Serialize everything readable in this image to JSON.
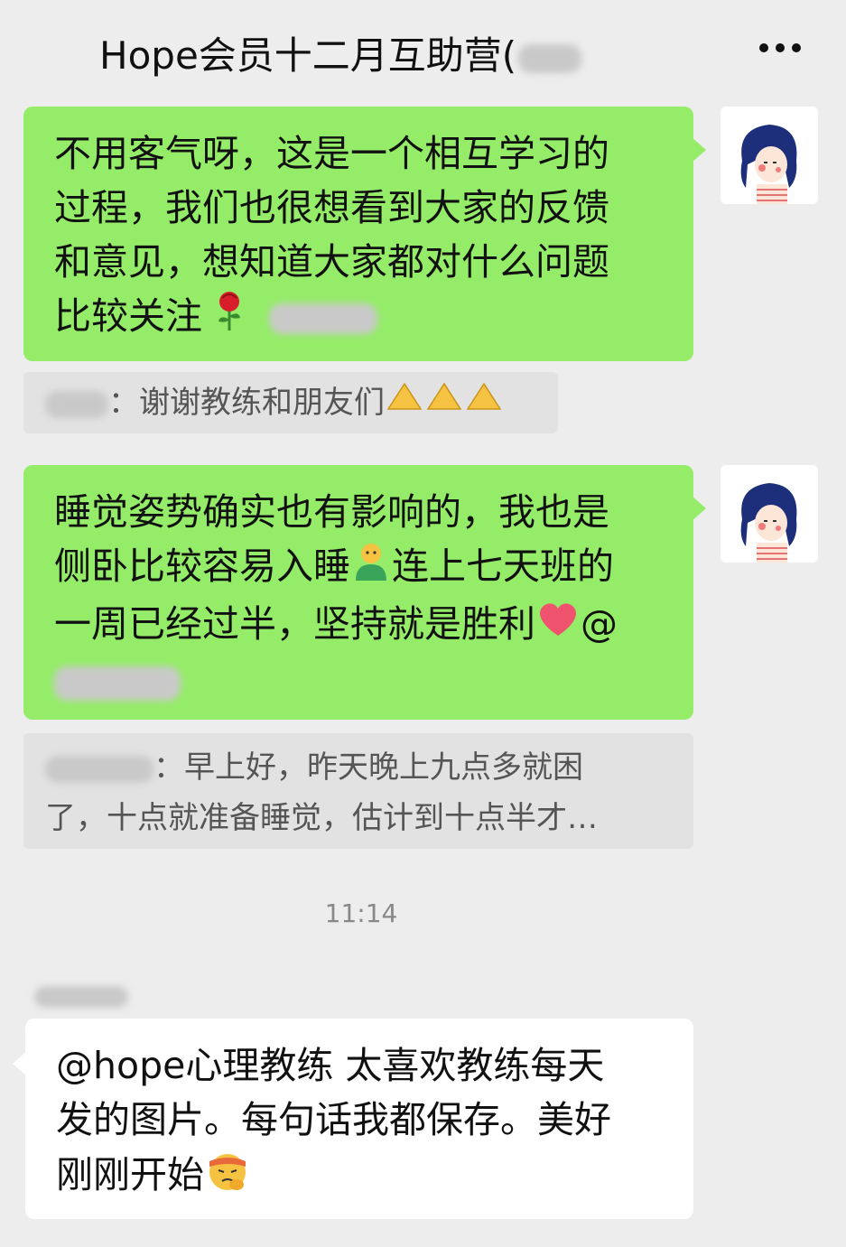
{
  "header": {
    "title": "Hope会员十二月互助营(",
    "more_icon": "more-dots-icon"
  },
  "messages": [
    {
      "side": "right",
      "lines": [
        "不用客气呀，这是一个相互学习的",
        "过程，我们也很想看到大家的反馈",
        "和意见，想知道大家都对什么问题",
        "比较关注"
      ],
      "emoji": "rose-icon"
    },
    {
      "quote_text": "：谢谢教练和朋友们"
    },
    {
      "side": "right",
      "lines": [
        "睡觉姿势确实也有影响的，我也是",
        "侧卧比较容易入睡",
        "连上七天班的",
        "一周已经过半，坚持就是胜利",
        "@"
      ]
    },
    {
      "quote_lines": [
        "：早上好，昨天晚上九点多就困",
        "了，十点就准备睡觉，估计到十点半才…"
      ]
    },
    {
      "timestamp": "11:14"
    },
    {
      "side": "left",
      "lines": [
        "@hope心理教练  太喜欢教练每天",
        "发的图片。每句话我都保存。美好",
        "刚刚开始"
      ]
    }
  ],
  "colors": {
    "background": "#ededed",
    "sent_bubble": "#95ec69",
    "received_bubble": "#ffffff",
    "quote_bg": "#e2e2e2"
  }
}
